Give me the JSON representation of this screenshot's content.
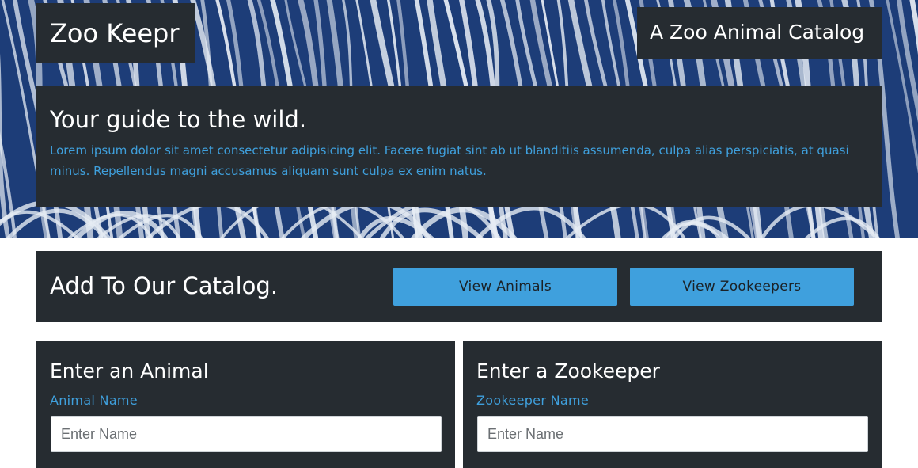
{
  "header": {
    "brand": "Zoo Keepr",
    "tagline": "A Zoo Animal Catalog",
    "intro_heading": "Your guide to the wild.",
    "intro_text": "Lorem ipsum dolor sit amet consectetur adipisicing elit. Facere fugiat sint ab ut blanditiis assumenda, culpa alias perspiciatis, at quasi minus. Repellendus magni accusamus aliquam sunt culpa ex enim natus."
  },
  "catalog": {
    "heading": "Add To Our Catalog.",
    "view_animals_label": "View Animals",
    "view_zookeepers_label": "View Zookeepers"
  },
  "animal_form": {
    "title": "Enter an Animal",
    "name_label": "Animal Name",
    "name_placeholder": "Enter Name"
  },
  "zookeeper_form": {
    "title": "Enter a Zookeeper",
    "name_label": "Zookeeper Name",
    "name_placeholder": "Enter Name"
  },
  "colors": {
    "panel_background": "#262c31",
    "accent": "#3fa0dd",
    "hero_stripe_blue": "#1d3d78",
    "hero_stripe_white": "#e6ecf4"
  },
  "hero_image": "zebra-stripe-pattern"
}
